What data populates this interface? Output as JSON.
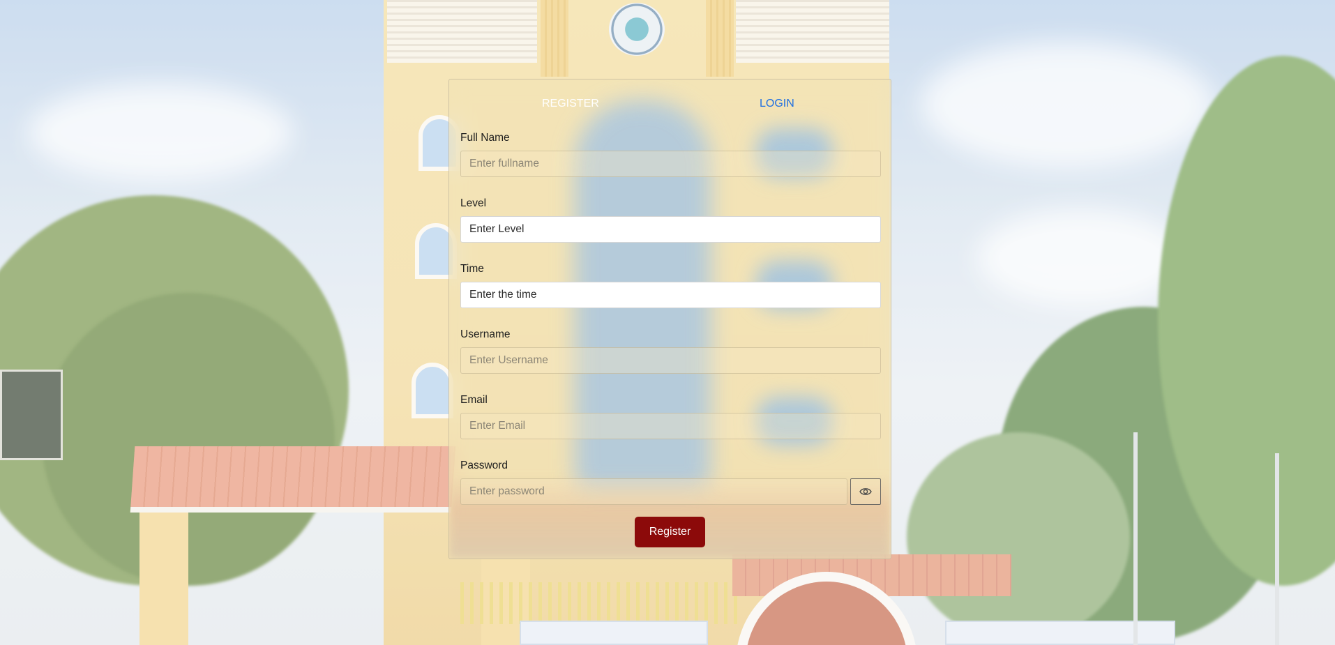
{
  "tabs": {
    "register_label": "REGISTER",
    "login_label": "LOGIN"
  },
  "form": {
    "fields": [
      {
        "label": "Full Name",
        "placeholder": "Enter fullname"
      },
      {
        "label": "Level",
        "placeholder": "Enter Level"
      },
      {
        "label": "Time",
        "placeholder": "Enter the time"
      },
      {
        "label": "Username",
        "placeholder": "Enter Username"
      },
      {
        "label": "Email",
        "placeholder": "Enter Email"
      },
      {
        "label": "Password",
        "placeholder": "Enter password"
      }
    ],
    "password_toggle_icon": "eye-icon",
    "submit_label": "Register"
  },
  "colors": {
    "active_tab_text": "#ffffff",
    "inactive_tab_text": "#1f6fe0",
    "submit_background": "#8c0a0a"
  }
}
